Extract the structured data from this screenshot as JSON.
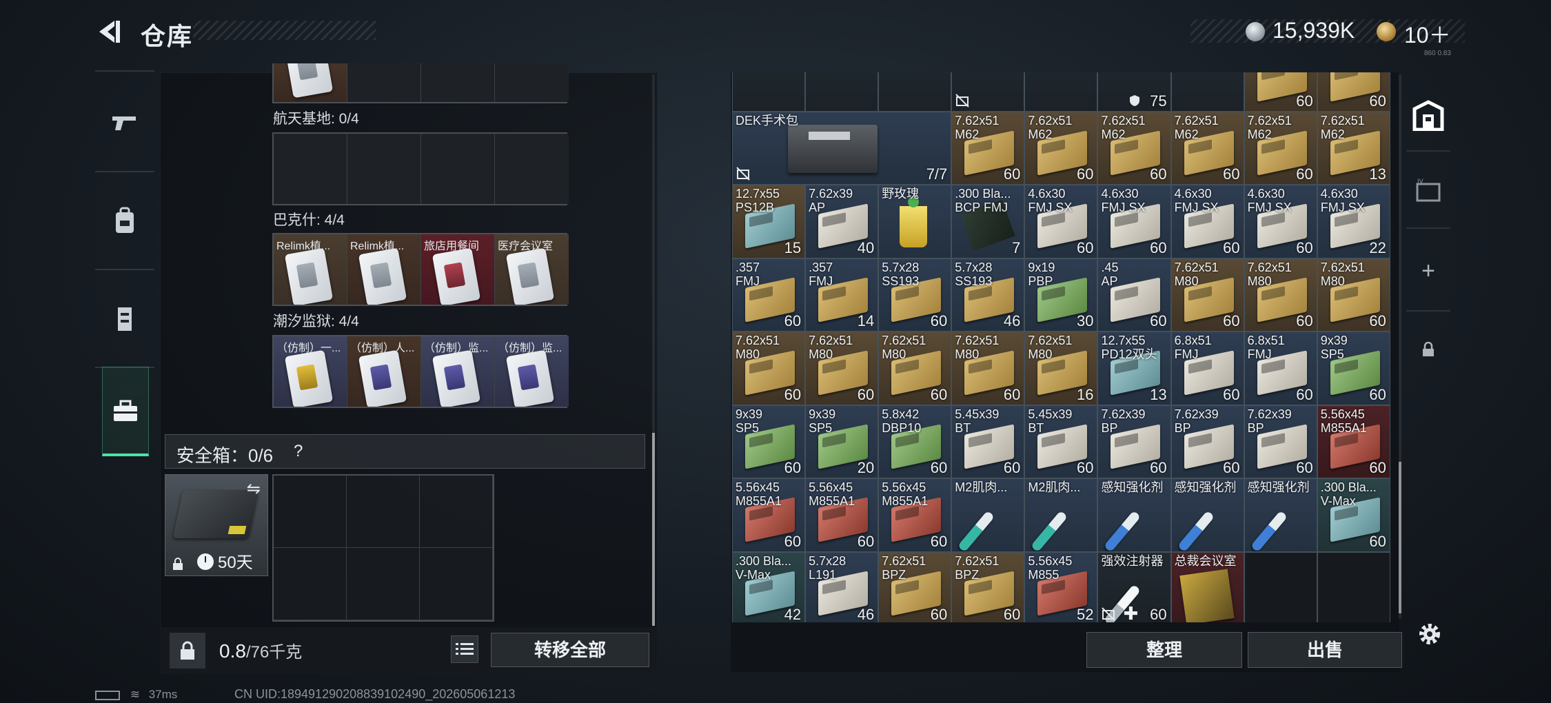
{
  "header": {
    "title": "仓库",
    "currency1": "15,939K",
    "currency2": "10＋",
    "version": "860 0.83"
  },
  "left_nav": [
    {
      "name": "weapons"
    },
    {
      "name": "backpack"
    },
    {
      "name": "rig"
    },
    {
      "name": "keys",
      "active": true
    }
  ],
  "keys_panel": {
    "sections": [
      {
        "label": "航天基地: 0/4",
        "cells": [
          "",
          "",
          "",
          ""
        ]
      },
      {
        "label": "巴克什: 4/4",
        "cells": [
          {
            "name": "Relimk植...",
            "color": "tan"
          },
          {
            "name": "Relimk植...",
            "color": "brown"
          },
          {
            "name": "旅店用餐间",
            "color": "red"
          },
          {
            "name": "医疗会议室",
            "color": "tan"
          }
        ]
      },
      {
        "label": "潮汐监狱: 4/4",
        "cells": [
          {
            "name": "（仿制）一...",
            "color": "blue"
          },
          {
            "name": "（仿制）人...",
            "color": "brown"
          },
          {
            "name": "（仿制）监...",
            "color": "blue"
          },
          {
            "name": "（仿制）监...",
            "color": "blue"
          }
        ]
      }
    ],
    "safe": {
      "title": "安全箱：0/6",
      "help": "?",
      "duration": "50天"
    },
    "footer": {
      "weight": "0.8",
      "weight_unit": "/76千克",
      "transfer_all": "转移全部"
    }
  },
  "inventory": {
    "top_row": [
      {
        "name": "",
        "count": "",
        "bg": "dark"
      },
      {
        "name": "",
        "count": "",
        "bg": "dark"
      },
      {
        "name": "",
        "count": "",
        "bg": "dark"
      },
      {
        "name": "",
        "count": "",
        "bg": "dark",
        "nosell": true
      },
      {
        "name": "",
        "count": "",
        "bg": "dark"
      },
      {
        "name": "",
        "count": "75",
        "bg": "dark",
        "armor": true
      },
      {
        "name": "",
        "count": "",
        "bg": "dark"
      },
      {
        "name": "",
        "count": "60",
        "bg": "tan",
        "box": "tan"
      },
      {
        "name": "",
        "count": "60",
        "bg": "tan",
        "box": "tan"
      }
    ],
    "medkit": {
      "name": "DEK手术包",
      "count": "7/7"
    },
    "row1_rest": [
      {
        "name": "7.62x51\nM62",
        "count": "60",
        "bg": "tan",
        "box": "tan"
      },
      {
        "name": "7.62x51\nM62",
        "count": "60",
        "bg": "tan",
        "box": "tan"
      },
      {
        "name": "7.62x51\nM62",
        "count": "60",
        "bg": "tan",
        "box": "tan"
      },
      {
        "name": "7.62x51\nM62",
        "count": "60",
        "bg": "tan",
        "box": "tan"
      },
      {
        "name": "7.62x51\nM62",
        "count": "60",
        "bg": "tan",
        "box": "tan"
      },
      {
        "name": "7.62x51\nM62",
        "count": "13",
        "bg": "tan",
        "box": "tan"
      }
    ],
    "rows": [
      [
        {
          "name": "12.7x55\nPS12B",
          "count": "15",
          "bg": "tan",
          "box": "teal"
        },
        {
          "name": "7.62x39\nAP",
          "count": "40",
          "bg": "blue",
          "box": "white"
        },
        {
          "name": "野玫瑰",
          "count": "",
          "bg": "blue",
          "drink": true
        },
        {
          "name": ".300 Bla...\nBCP FMJ",
          "count": "7",
          "bg": "blue",
          "rifle": true
        },
        {
          "name": "4.6x30\nFMJ SX",
          "count": "60",
          "bg": "blue",
          "box": "white"
        },
        {
          "name": "4.6x30\nFMJ SX",
          "count": "60",
          "bg": "blue",
          "box": "white"
        },
        {
          "name": "4.6x30\nFMJ SX",
          "count": "60",
          "bg": "blue",
          "box": "white"
        },
        {
          "name": "4.6x30\nFMJ SX",
          "count": "60",
          "bg": "blue",
          "box": "white"
        },
        {
          "name": "4.6x30\nFMJ SX",
          "count": "22",
          "bg": "blue",
          "box": "white"
        }
      ],
      [
        {
          "name": ".357\nFMJ",
          "count": "60",
          "bg": "blue",
          "box": "tan"
        },
        {
          "name": ".357\nFMJ",
          "count": "14",
          "bg": "blue",
          "box": "tan"
        },
        {
          "name": "5.7x28\nSS193",
          "count": "60",
          "bg": "blue",
          "box": "tan"
        },
        {
          "name": "5.7x28\nSS193",
          "count": "46",
          "bg": "blue",
          "box": "tan"
        },
        {
          "name": "9x19\nPBP",
          "count": "30",
          "bg": "blue",
          "box": "green"
        },
        {
          "name": ".45\nAP",
          "count": "60",
          "bg": "blue",
          "box": "white"
        },
        {
          "name": "7.62x51\nM80",
          "count": "60",
          "bg": "tan",
          "box": "tan"
        },
        {
          "name": "7.62x51\nM80",
          "count": "60",
          "bg": "tan",
          "box": "tan"
        },
        {
          "name": "7.62x51\nM80",
          "count": "60",
          "bg": "tan",
          "box": "tan"
        }
      ],
      [
        {
          "name": "7.62x51\nM80",
          "count": "60",
          "bg": "tan",
          "box": "tan"
        },
        {
          "name": "7.62x51\nM80",
          "count": "60",
          "bg": "tan",
          "box": "tan"
        },
        {
          "name": "7.62x51\nM80",
          "count": "60",
          "bg": "tan",
          "box": "tan"
        },
        {
          "name": "7.62x51\nM80",
          "count": "60",
          "bg": "tan",
          "box": "tan"
        },
        {
          "name": "7.62x51\nM80",
          "count": "16",
          "bg": "tan",
          "box": "tan"
        },
        {
          "name": "12.7x55\nPD12双头",
          "count": "13",
          "bg": "blue",
          "box": "teal"
        },
        {
          "name": "6.8x51\nFMJ",
          "count": "60",
          "bg": "blue",
          "box": "white"
        },
        {
          "name": "6.8x51\nFMJ",
          "count": "60",
          "bg": "blue",
          "box": "white"
        },
        {
          "name": "9x39\nSP5",
          "count": "60",
          "bg": "blue",
          "box": "green"
        }
      ],
      [
        {
          "name": "9x39\nSP5",
          "count": "60",
          "bg": "blue",
          "box": "green"
        },
        {
          "name": "9x39\nSP5",
          "count": "20",
          "bg": "blue",
          "box": "green"
        },
        {
          "name": "5.8x42\nDBP10",
          "count": "60",
          "bg": "blue",
          "box": "green"
        },
        {
          "name": "5.45x39\nBT",
          "count": "60",
          "bg": "blue",
          "box": "white"
        },
        {
          "name": "5.45x39\nBT",
          "count": "60",
          "bg": "blue",
          "box": "white"
        },
        {
          "name": "7.62x39\nBP",
          "count": "60",
          "bg": "blue",
          "box": "white"
        },
        {
          "name": "7.62x39\nBP",
          "count": "60",
          "bg": "blue",
          "box": "white"
        },
        {
          "name": "7.62x39\nBP",
          "count": "60",
          "bg": "blue",
          "box": "white"
        },
        {
          "name": "5.56x45\nM855A1",
          "count": "60",
          "bg": "red",
          "box": "red"
        }
      ],
      [
        {
          "name": "5.56x45\nM855A1",
          "count": "60",
          "bg": "blue",
          "box": "red"
        },
        {
          "name": "5.56x45\nM855A1",
          "count": "60",
          "bg": "blue",
          "box": "red"
        },
        {
          "name": "5.56x45\nM855A1",
          "count": "60",
          "bg": "blue",
          "box": "red"
        },
        {
          "name": "M2肌肉...",
          "count": "",
          "bg": "blue",
          "inj": "teal"
        },
        {
          "name": "M2肌肉...",
          "count": "",
          "bg": "blue",
          "inj": "teal"
        },
        {
          "name": "感知强化剂",
          "count": "",
          "bg": "blue",
          "inj": "blue"
        },
        {
          "name": "感知强化剂",
          "count": "",
          "bg": "blue",
          "inj": "blue"
        },
        {
          "name": "感知强化剂",
          "count": "",
          "bg": "blue",
          "inj": "blue"
        },
        {
          "name": ".300 Bla...\nV-Max",
          "count": "60",
          "bg": "teal",
          "box": "teal"
        }
      ],
      [
        {
          "name": ".300 Bla...\nV-Max",
          "count": "42",
          "bg": "teal",
          "box": "teal"
        },
        {
          "name": "5.7x28\nL191",
          "count": "46",
          "bg": "blue",
          "box": "white"
        },
        {
          "name": "7.62x51\nBPZ",
          "count": "60",
          "bg": "tan",
          "box": "tan"
        },
        {
          "name": "7.62x51\nBPZ",
          "count": "60",
          "bg": "tan",
          "box": "tan"
        },
        {
          "name": "5.56x45\nM855",
          "count": "52",
          "bg": "blue",
          "box": "red"
        },
        {
          "name": "强效注射器",
          "count": "60",
          "bg": "dark",
          "inj": "white",
          "nosell": true,
          "plus": "✚"
        },
        {
          "name": "总裁会议室",
          "count": "",
          "bg": "red",
          "folder": true
        },
        {
          "name": "",
          "count": "",
          "bg": "empty"
        },
        {
          "name": "",
          "count": "",
          "bg": "empty"
        }
      ]
    ],
    "buttons": {
      "sort": "整理",
      "sell": "出售"
    }
  },
  "status": {
    "ping": "37ms",
    "uid": "CN UID:1894912902088391024​90_202605061213"
  }
}
